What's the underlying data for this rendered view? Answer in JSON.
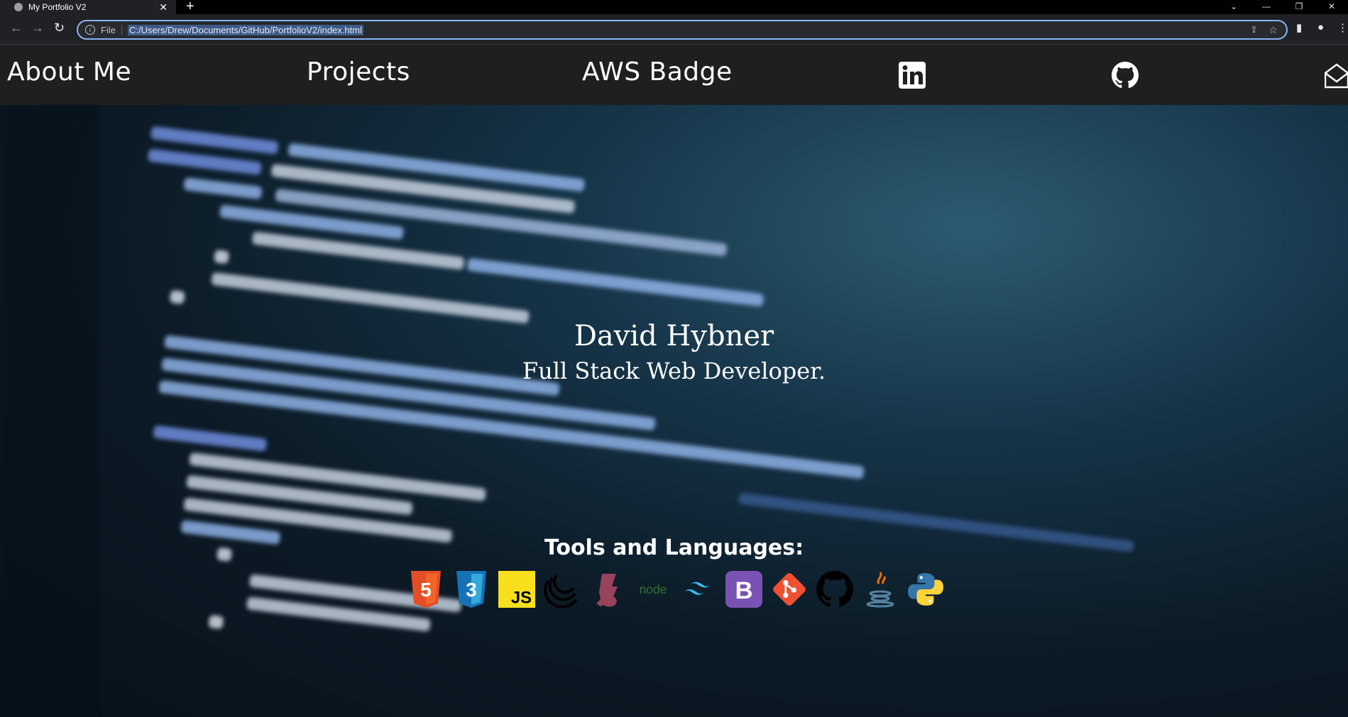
{
  "browser": {
    "tab_title": "My Portfolio V2",
    "new_tab": "+",
    "scheme_label": "File",
    "url": "C:/Users/Drew/Documents/GitHub/PortfolioV2/index.html"
  },
  "nav": {
    "about": "About Me",
    "projects": "Projects",
    "aws": "AWS Badge",
    "social_icons": [
      "linkedin-icon",
      "github-icon",
      "mail-icon"
    ]
  },
  "hero": {
    "name": "David Hybner",
    "role": "Full Stack Web Developer."
  },
  "tools": {
    "title": "Tools and Languages:",
    "icons": [
      "html5",
      "css3",
      "javascript",
      "jest",
      "jest-alt",
      "nodejs",
      "tailwind",
      "bootstrap",
      "git",
      "github",
      "java",
      "python"
    ]
  },
  "colors": {
    "nav_bg": "#1e1f21",
    "accent_url_highlight": "#3d5a8a",
    "omnibox_border": "#8ab4f8"
  }
}
